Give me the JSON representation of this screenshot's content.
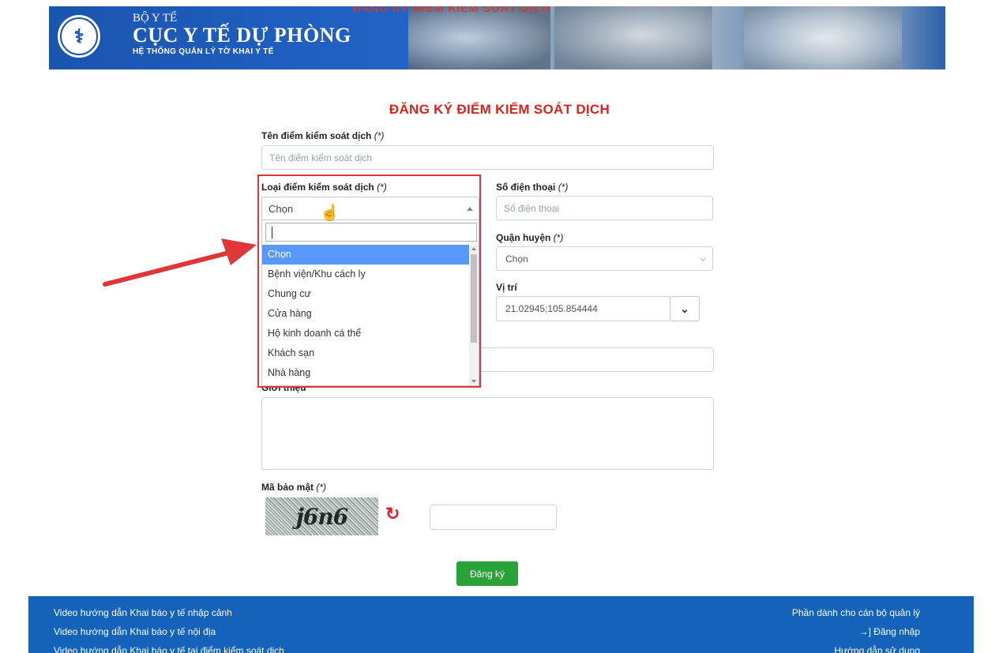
{
  "header": {
    "ministry": "BỘ Y TẾ",
    "department": "CỤC Y TẾ DỰ PHÒNG",
    "system": "HỆ THỐNG QUẢN LÝ TỜ KHAI Y TẾ",
    "banner_overlay_text": "ĐĂNG KÝ ĐIỂM KIỂM SOÁT DỊCH"
  },
  "form": {
    "title": "ĐĂNG KÝ ĐIỂM KIỂM SOÁT DỊCH",
    "required_mark": "(*)",
    "name": {
      "label": "Tên điểm kiểm soát dịch",
      "placeholder": "Tên điểm kiểm soát dịch"
    },
    "type": {
      "label": "Loại điểm kiểm soát dịch",
      "selected": "Chọn",
      "search_value": "",
      "options": [
        "Chọn",
        "Bệnh viện/Khu cách ly",
        "Chung cư",
        "Cửa hàng",
        "Hộ kinh doanh cá thể",
        "Khách sạn",
        "Nhà hàng"
      ],
      "highlighted_option": "Chọn"
    },
    "phone": {
      "label": "Số điện thoại",
      "placeholder": "Số điện thoại"
    },
    "district": {
      "label": "Quận huyện",
      "selected": "Chọn"
    },
    "location": {
      "label": "Vị trí",
      "value": "21.02945;105.854444"
    },
    "intro": {
      "label": "Giới thiệu",
      "value": ""
    },
    "captcha": {
      "label": "Mã bảo mật",
      "image_text": "j6n6",
      "value": ""
    },
    "submit_label": "Đăng ký"
  },
  "footer": {
    "left_links": [
      "Video hướng dẫn Khai báo y tế nhập cảnh",
      "Video hướng dẫn Khai báo y tế nội địa",
      "Video hướng dẫn Khai báo y tế tại điểm kiểm soát dịch"
    ],
    "right_title": "Phần dành cho cán bộ quản lý",
    "login_label": "Đăng nhập",
    "guide_label": "Hướng dẫn sử dụng"
  },
  "colors": {
    "brand_blue": "#1462b9",
    "title_red": "#d9231d",
    "submit_green": "#2aa23a",
    "highlight": "#5897fb",
    "annotation_red": "#e0363a"
  },
  "icons": {
    "refresh": "refresh-icon",
    "login": "sign-in-icon",
    "location_toggle": "chevron-down-icon"
  }
}
